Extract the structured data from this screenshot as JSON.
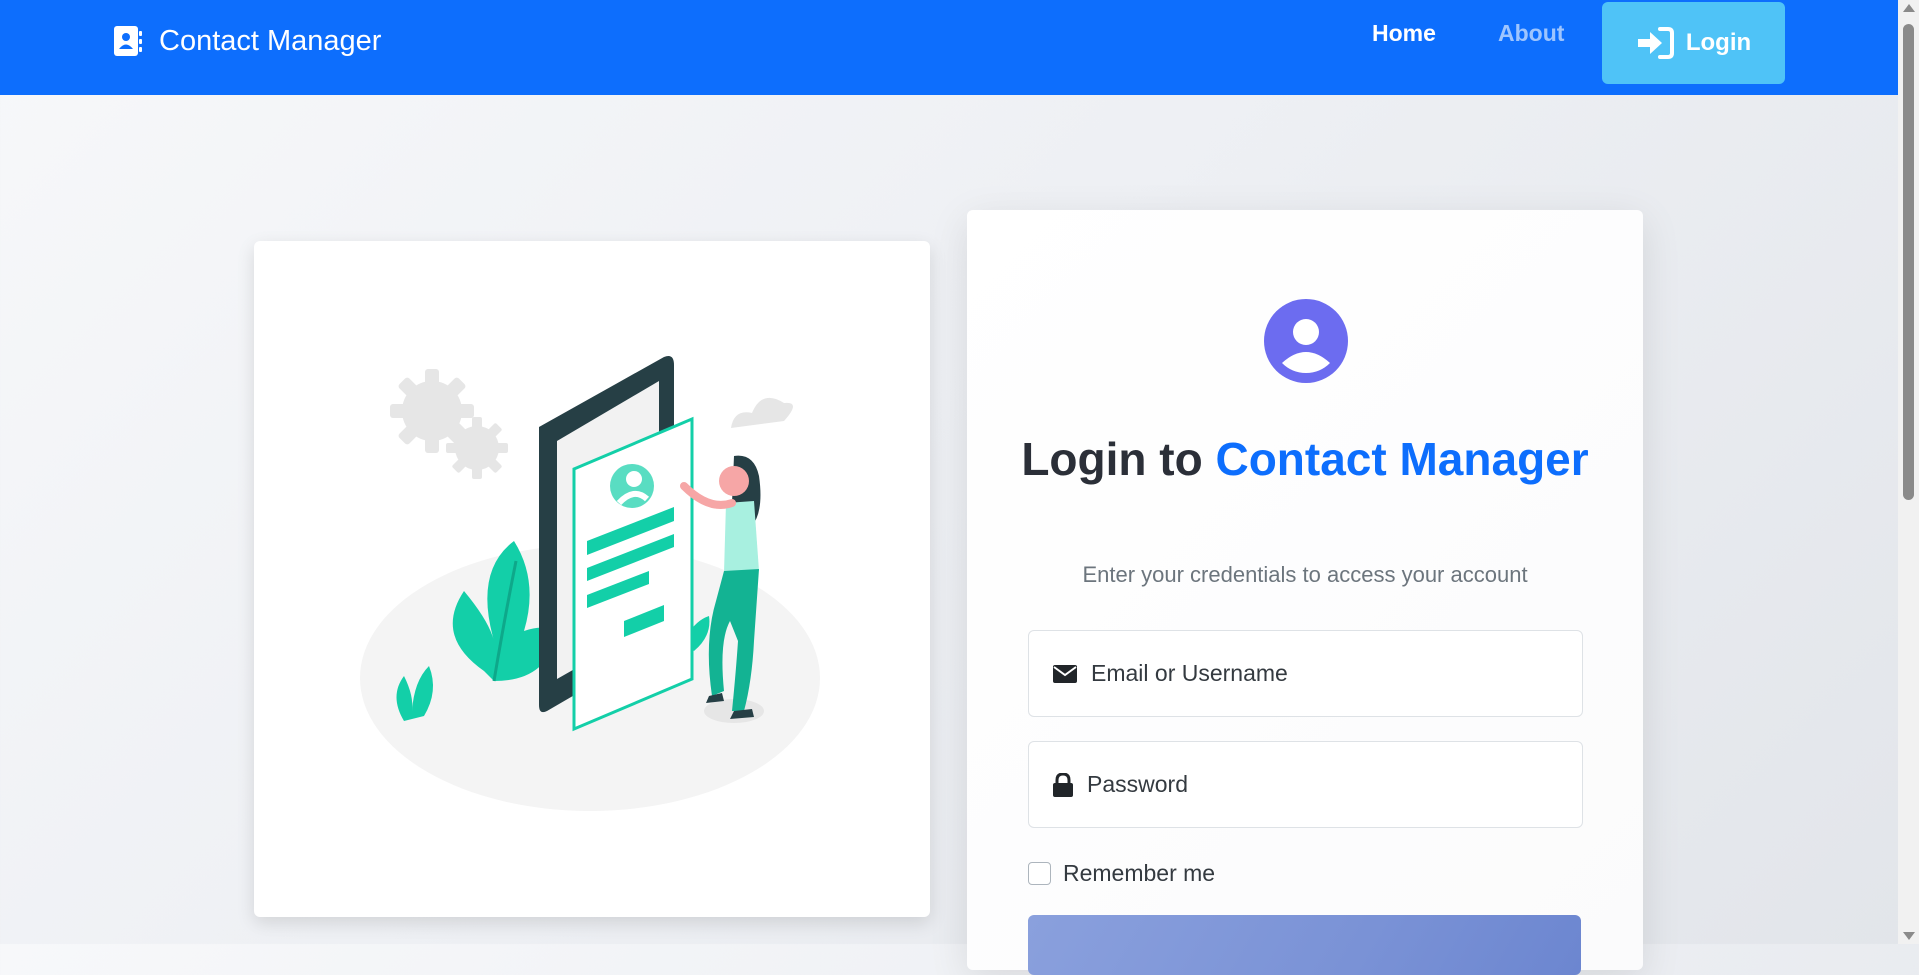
{
  "navbar": {
    "brand": "Contact Manager",
    "links": [
      {
        "label": "Home"
      },
      {
        "label": "About"
      }
    ],
    "login_button": "Login",
    "colors": {
      "primary": "#0d6efd",
      "login_button_bg": "#4fc3f7",
      "muted_link": "#9ec5fe"
    }
  },
  "login_card": {
    "title_prefix": "Login to",
    "title_accent": "Contact Manager",
    "subtitle": "Enter your credentials to access your account",
    "email_placeholder": "Email or Username",
    "password_placeholder": "Password",
    "remember_label": "Remember me",
    "remember_checked": false,
    "avatar_color": "#6c6cf0"
  },
  "icons": {
    "brand": "address-book-icon",
    "login_button": "sign-in-icon",
    "avatar": "user-circle-icon",
    "email": "envelope-icon",
    "password": "lock-icon"
  }
}
